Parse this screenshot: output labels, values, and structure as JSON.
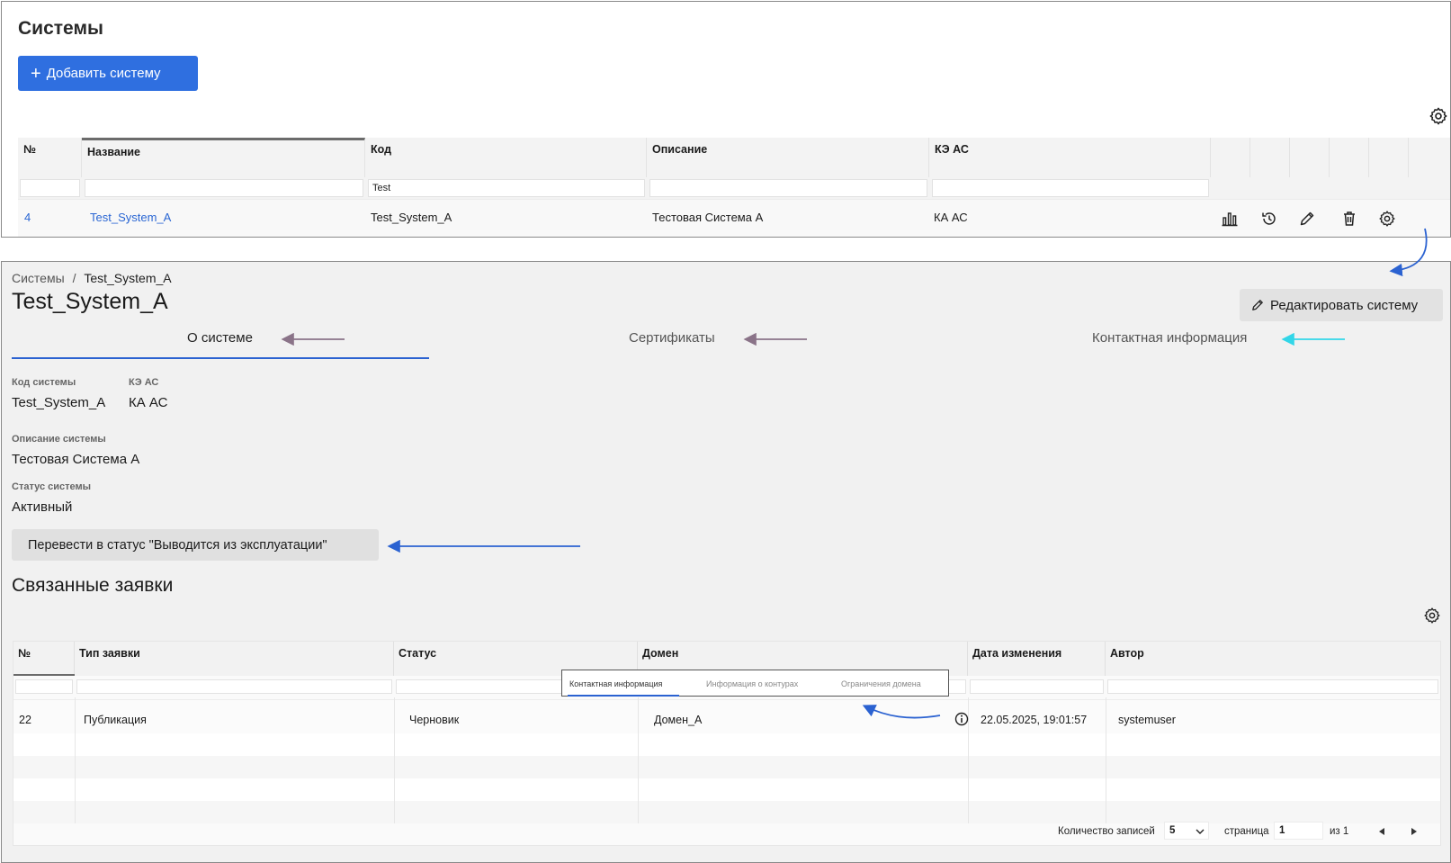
{
  "top": {
    "title": "Системы",
    "add_button": "Добавить систему",
    "plus": "+",
    "columns": [
      "№",
      "Название",
      "Код",
      "Описание",
      "КЭ АС"
    ],
    "filters": {
      "code": "Test"
    },
    "row": {
      "num": "4",
      "name": "Test_System_A",
      "code": "Test_System_A",
      "description": "Тестовая Система А",
      "ke": "КА АС"
    }
  },
  "detail": {
    "breadcrumb_root": "Системы",
    "breadcrumb_sep": "/",
    "breadcrumb_current": "Test_System_A",
    "title": "Test_System_A",
    "edit_button": "Редактировать систему",
    "tabs": [
      "О системе",
      "Сертификаты",
      "Контактная информация"
    ],
    "fields": {
      "code_label": "Код системы",
      "code_value": "Test_System_A",
      "ke_label": "КЭ АС",
      "ke_value": "КА АС",
      "desc_label": "Описание системы",
      "desc_value": "Тестовая Система А",
      "status_label": "Статус системы",
      "status_value": "Активный"
    },
    "status_button": "Перевести в статус \"Выводится из эксплуатации\"",
    "related_title": "Связанные заявки"
  },
  "requests": {
    "columns": [
      "№",
      "Тип заявки",
      "Статус",
      "Домен",
      "Дата изменения",
      "Автор"
    ],
    "row": {
      "num": "22",
      "type": "Публикация",
      "status": "Черновик",
      "domain": "Домен_А",
      "date": "22.05.2025, 19:01:57",
      "author": "systemuser"
    },
    "inset_tabs": [
      "Контактная информация",
      "Информация о контурах",
      "Ограничения домена"
    ],
    "footer": {
      "records_label": "Количество записей",
      "records_value": "5",
      "page_label": "страница",
      "page_value": "1",
      "of_label": "из 1"
    }
  },
  "colors": {
    "accent": "#2f6fe0",
    "arrow_blue": "#2b62d1",
    "arrow_purple": "#8a7388",
    "arrow_cyan": "#32d6e8"
  }
}
